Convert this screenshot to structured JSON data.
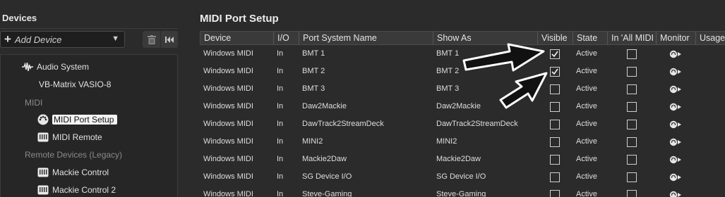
{
  "left": {
    "devices_title": "Devices",
    "add_device_label": "Add Device",
    "tree": {
      "audio_system": "Audio System",
      "vb_matrix": "VB-Matrix VASIO-8",
      "midi_section": "MIDI",
      "midi_port_setup": "MIDI Port Setup",
      "midi_remote": "MIDI Remote",
      "remote_section": "Remote Devices (Legacy)",
      "mackie_control": "Mackie Control",
      "mackie_control_2": "Mackie Control 2"
    }
  },
  "right": {
    "title": "MIDI Port Setup",
    "columns": {
      "device": "Device",
      "io": "I/O",
      "port": "Port System Name",
      "show": "Show As",
      "visible": "Visible",
      "state": "State",
      "allmidi": "In 'All MIDI",
      "monitor": "Monitor",
      "usage": "Usage"
    },
    "rows": [
      {
        "device": "Windows MIDI",
        "io": "In",
        "port": "BMT 1",
        "show": "BMT 1",
        "visible": true,
        "state": "Active",
        "allmidi": false
      },
      {
        "device": "Windows MIDI",
        "io": "In",
        "port": "BMT 2",
        "show": "BMT 2",
        "visible": true,
        "state": "Active",
        "allmidi": false
      },
      {
        "device": "Windows MIDI",
        "io": "In",
        "port": "BMT 3",
        "show": "BMT 3",
        "visible": false,
        "state": "Active",
        "allmidi": false
      },
      {
        "device": "Windows MIDI",
        "io": "In",
        "port": "Daw2Mackie",
        "show": "Daw2Mackie",
        "visible": false,
        "state": "Active",
        "allmidi": false
      },
      {
        "device": "Windows MIDI",
        "io": "In",
        "port": "DawTrack2StreamDeck",
        "show": "DawTrack2StreamDeck",
        "visible": false,
        "state": "Active",
        "allmidi": false
      },
      {
        "device": "Windows MIDI",
        "io": "In",
        "port": "MINI2",
        "show": "MINI2",
        "visible": false,
        "state": "Active",
        "allmidi": false
      },
      {
        "device": "Windows MIDI",
        "io": "In",
        "port": "Mackie2Daw",
        "show": "Mackie2Daw",
        "visible": false,
        "state": "Active",
        "allmidi": false
      },
      {
        "device": "Windows MIDI",
        "io": "In",
        "port": "SG Device I/O",
        "show": "SG Device I/O",
        "visible": false,
        "state": "Active",
        "allmidi": false
      },
      {
        "device": "Windows MIDI",
        "io": "In",
        "port": "Steve-Gaming",
        "show": "Steve-Gaming",
        "visible": false,
        "state": "Active",
        "allmidi": false
      }
    ]
  }
}
